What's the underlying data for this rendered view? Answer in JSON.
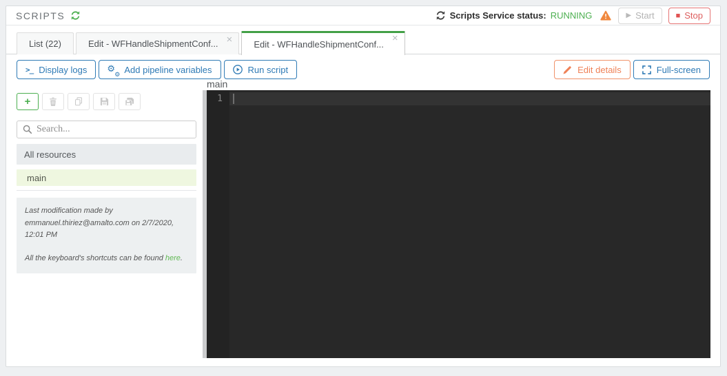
{
  "header": {
    "title": "SCRIPTS",
    "status_label": "Scripts Service status:",
    "status_value": "RUNNING",
    "start_label": "Start",
    "stop_label": "Stop"
  },
  "tabs": [
    {
      "label": "List (22)"
    },
    {
      "label": "Edit - WFHandleShipmentConf..."
    },
    {
      "label": "Edit - WFHandleShipmentConf..."
    }
  ],
  "toolbar": {
    "display_logs": "Display logs",
    "add_pipeline_variables": "Add pipeline variables",
    "run_script": "Run script",
    "edit_details": "Edit details",
    "full_screen": "Full-screen"
  },
  "sidebar": {
    "search_placeholder": "Search...",
    "group_header": "All resources",
    "resource": "main",
    "info_line1": "Last modification made by emmanuel.thiriez@amalto.com on 2/7/2020, 12:01 PM",
    "info_line2_prefix": "All the keyboard's shortcuts can be found ",
    "info_link": "here",
    "info_suffix": "."
  },
  "editor": {
    "resource_label": "main",
    "line_number": "1"
  },
  "icons": {
    "close": "×",
    "plus": "+",
    "play": "▶",
    "stop": "■",
    "prompt": ">_",
    "gear": "⚙"
  },
  "colors": {
    "green": "#4caf50",
    "blue": "#2e7ab5",
    "orange": "#ef8157",
    "red": "#e05c5c",
    "warning_orange": "#f0883e"
  }
}
